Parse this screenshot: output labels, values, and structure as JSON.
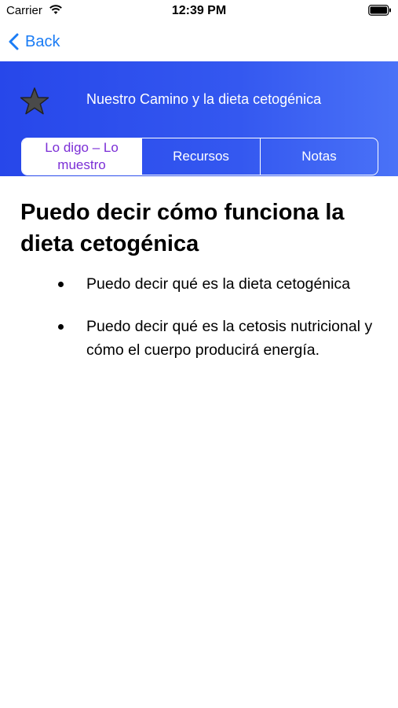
{
  "status_bar": {
    "carrier": "Carrier",
    "time": "12:39 PM",
    "icons": [
      "wifi-icon",
      "battery-icon"
    ]
  },
  "nav": {
    "back_label": "Back",
    "accent_color": "#1a7cf5"
  },
  "header": {
    "title": "Nuestro Camino y la dieta cetogénica",
    "icon": "star-icon",
    "gradient": [
      "#2747ea",
      "#4a72f7"
    ]
  },
  "tabs": [
    {
      "label": "Lo digo – Lo muestro",
      "active": true,
      "active_color": "#7b2ed6"
    },
    {
      "label": "Recursos",
      "active": false
    },
    {
      "label": "Notas",
      "active": false
    }
  ],
  "content": {
    "title": "Puedo decir cómo funciona la dieta cetogénica",
    "bullets": [
      "Puedo decir qué es la dieta cetogénica",
      "Puedo decir qué es la cetosis nutricional y cómo el cuerpo producirá energía."
    ]
  }
}
